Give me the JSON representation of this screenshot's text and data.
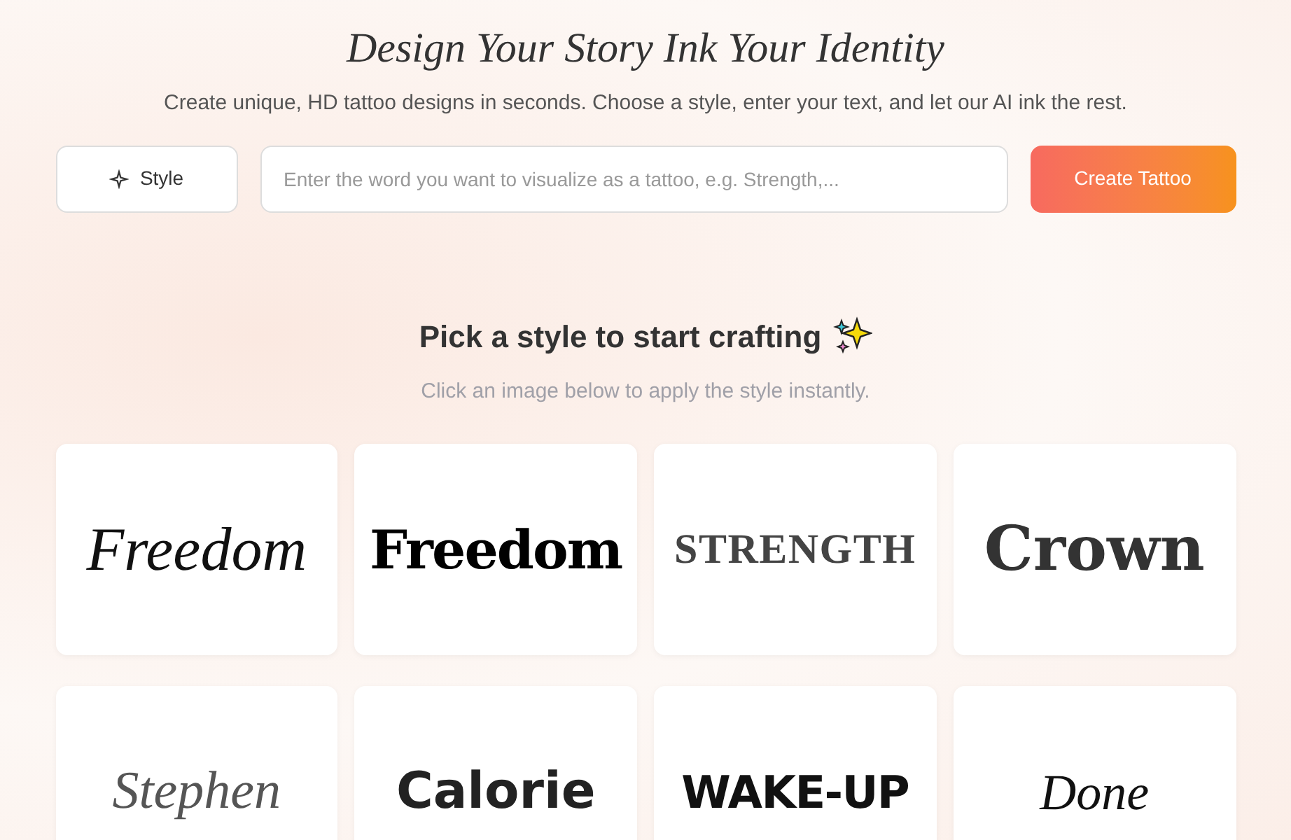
{
  "hero": {
    "title": "Design Your Story Ink Your Identity",
    "subtitle": "Create unique, HD tattoo designs in seconds. Choose a style, enter your text, and let our AI ink the rest."
  },
  "form": {
    "style_button": "Style",
    "placeholder": "Enter the word you want to visualize as a tattoo, e.g. Strength,...",
    "submit": "Create Tattoo"
  },
  "gallery": {
    "heading": "Pick a style to start crafting",
    "hint": "Click an image below to apply the style instantly.",
    "styles": [
      {
        "kind": "script",
        "label": "Freedom"
      },
      {
        "kind": "blackletter",
        "label": "Freedom"
      },
      {
        "kind": "engraved",
        "label": "STRENGTH"
      },
      {
        "kind": "gothic",
        "label": "Crown"
      },
      {
        "kind": "signature",
        "label": "Stephen"
      },
      {
        "kind": "graffiti",
        "label": "Calorie"
      },
      {
        "kind": "bold",
        "label": "WAKE-UP"
      },
      {
        "kind": "handwritten",
        "label": "Done"
      }
    ]
  }
}
